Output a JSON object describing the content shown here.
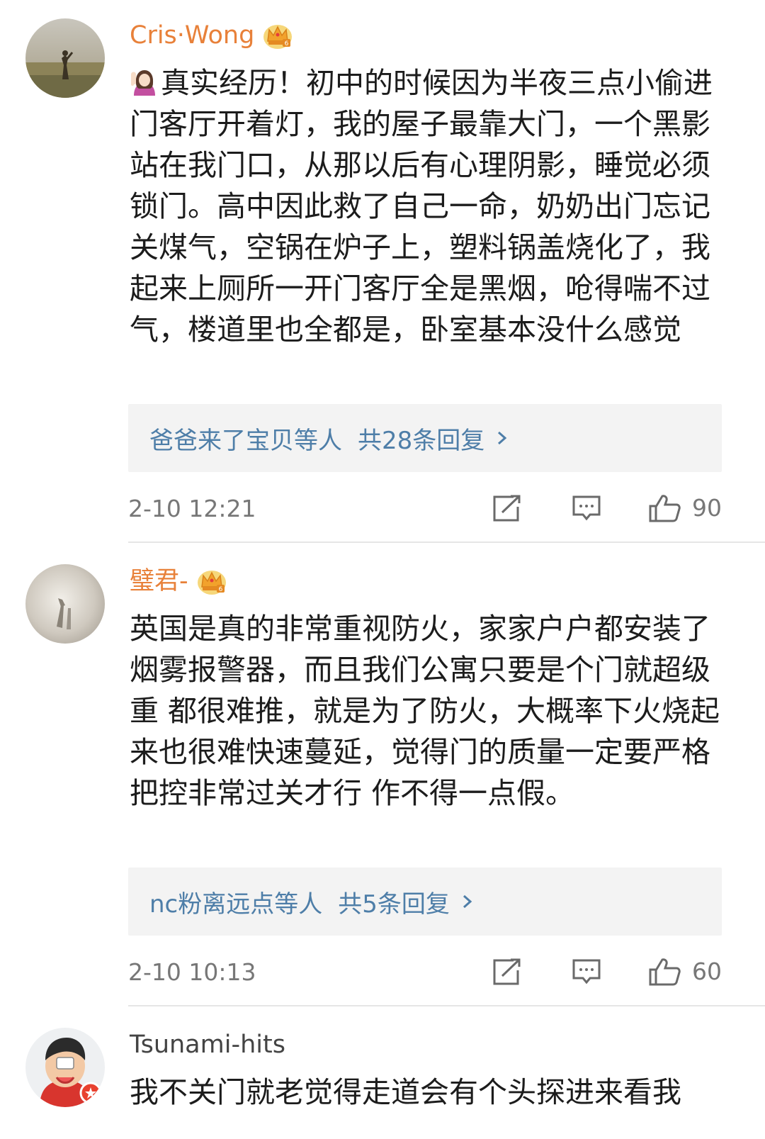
{
  "colors": {
    "vip_username": "#e8813a",
    "link_blue": "#4e7ea8",
    "meta_gray": "#777777",
    "reply_bg": "#f3f3f3"
  },
  "comments": [
    {
      "username": "Cris·Wong",
      "badge": "crown-icon",
      "text": "真实经历！初中的时候因为半夜三点小偷进门客厅开着灯，我的屋子最靠大门，一个黑影站在我门口，从那以后有心理阴影，睡觉必须锁门。高中因此救了自己一命，奶奶出门忘记关煤气，空锅在炉子上，塑料锅盖烧化了，我起来上厕所一开门客厅全是黑烟，呛得喘不过气，楼道里也全都是，卧室基本没什么感觉",
      "reply_users": "爸爸来了宝贝等人",
      "reply_count": "共28条回复",
      "time": "2-10 12:21",
      "likes": "90"
    },
    {
      "username": "璧君-",
      "badge": "crown-icon",
      "text": "英国是真的非常重视防火，家家户户都安装了烟雾报警器，而且我们公寓只要是个门就超级重 都很难推，就是为了防火，大概率下火烧起来也很难快速蔓延，觉得门的质量一定要严格把控非常过关才行 作不得一点假。",
      "reply_users": "nc粉离远点等人",
      "reply_count": "共5条回复",
      "time": "2-10 10:13",
      "likes": "60"
    },
    {
      "username": "Tsunami-hits",
      "text": "我不关门就老觉得走道会有个头探进来看我"
    }
  ]
}
